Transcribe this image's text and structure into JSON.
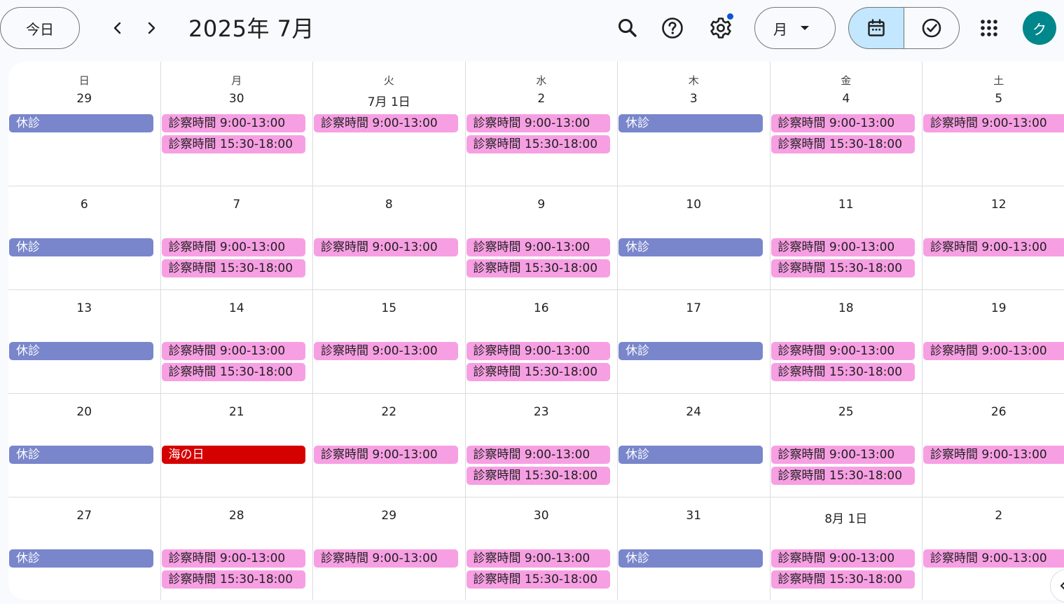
{
  "header": {
    "today_label": "今日",
    "month_title": "2025年 7月",
    "view_label": "月",
    "avatar_initial": "ク"
  },
  "colors": {
    "closed": "#7986cb",
    "hours": "#f79fe3",
    "holiday": "#d50000",
    "selected_segment": "#c2e7ff",
    "avatar": "#00878c",
    "notification_dot": "#0b57d0"
  },
  "weekdays": [
    "日",
    "月",
    "火",
    "水",
    "木",
    "金",
    "土"
  ],
  "weeks": [
    [
      {
        "date": "29",
        "events": [
          {
            "title": "休診",
            "kind": "closed"
          }
        ]
      },
      {
        "date": "30",
        "events": [
          {
            "title": "診察時間 9:00-13:00",
            "kind": "hours"
          },
          {
            "title": "診察時間 15:30-18:00",
            "kind": "hours"
          }
        ]
      },
      {
        "date": "7月 1日",
        "events": [
          {
            "title": "診察時間 9:00-13:00",
            "kind": "hours"
          }
        ]
      },
      {
        "date": "2",
        "events": [
          {
            "title": "診察時間 9:00-13:00",
            "kind": "hours"
          },
          {
            "title": "診察時間 15:30-18:00",
            "kind": "hours"
          }
        ]
      },
      {
        "date": "3",
        "events": [
          {
            "title": "休診",
            "kind": "closed"
          }
        ]
      },
      {
        "date": "4",
        "events": [
          {
            "title": "診察時間 9:00-13:00",
            "kind": "hours"
          },
          {
            "title": "診察時間 15:30-18:00",
            "kind": "hours"
          }
        ]
      },
      {
        "date": "5",
        "events": [
          {
            "title": "診察時間 9:00-13:00",
            "kind": "hours"
          }
        ]
      }
    ],
    [
      {
        "date": "6",
        "events": [
          {
            "title": "休診",
            "kind": "closed"
          }
        ]
      },
      {
        "date": "7",
        "events": [
          {
            "title": "診察時間 9:00-13:00",
            "kind": "hours"
          },
          {
            "title": "診察時間 15:30-18:00",
            "kind": "hours"
          }
        ]
      },
      {
        "date": "8",
        "events": [
          {
            "title": "診察時間 9:00-13:00",
            "kind": "hours"
          }
        ]
      },
      {
        "date": "9",
        "events": [
          {
            "title": "診察時間 9:00-13:00",
            "kind": "hours"
          },
          {
            "title": "診察時間 15:30-18:00",
            "kind": "hours"
          }
        ]
      },
      {
        "date": "10",
        "events": [
          {
            "title": "休診",
            "kind": "closed"
          }
        ]
      },
      {
        "date": "11",
        "events": [
          {
            "title": "診察時間 9:00-13:00",
            "kind": "hours"
          },
          {
            "title": "診察時間 15:30-18:00",
            "kind": "hours"
          }
        ]
      },
      {
        "date": "12",
        "events": [
          {
            "title": "診察時間 9:00-13:00",
            "kind": "hours"
          }
        ]
      }
    ],
    [
      {
        "date": "13",
        "events": [
          {
            "title": "休診",
            "kind": "closed"
          }
        ]
      },
      {
        "date": "14",
        "events": [
          {
            "title": "診察時間 9:00-13:00",
            "kind": "hours"
          },
          {
            "title": "診察時間 15:30-18:00",
            "kind": "hours"
          }
        ]
      },
      {
        "date": "15",
        "events": [
          {
            "title": "診察時間 9:00-13:00",
            "kind": "hours"
          }
        ]
      },
      {
        "date": "16",
        "events": [
          {
            "title": "診察時間 9:00-13:00",
            "kind": "hours"
          },
          {
            "title": "診察時間 15:30-18:00",
            "kind": "hours"
          }
        ]
      },
      {
        "date": "17",
        "events": [
          {
            "title": "休診",
            "kind": "closed"
          }
        ]
      },
      {
        "date": "18",
        "events": [
          {
            "title": "診察時間 9:00-13:00",
            "kind": "hours"
          },
          {
            "title": "診察時間 15:30-18:00",
            "kind": "hours"
          }
        ]
      },
      {
        "date": "19",
        "events": [
          {
            "title": "診察時間 9:00-13:00",
            "kind": "hours"
          }
        ]
      }
    ],
    [
      {
        "date": "20",
        "events": [
          {
            "title": "休診",
            "kind": "closed"
          }
        ]
      },
      {
        "date": "21",
        "events": [
          {
            "title": "海の日",
            "kind": "holiday"
          }
        ]
      },
      {
        "date": "22",
        "events": [
          {
            "title": "診察時間 9:00-13:00",
            "kind": "hours"
          }
        ]
      },
      {
        "date": "23",
        "events": [
          {
            "title": "診察時間 9:00-13:00",
            "kind": "hours"
          },
          {
            "title": "診察時間 15:30-18:00",
            "kind": "hours"
          }
        ]
      },
      {
        "date": "24",
        "events": [
          {
            "title": "休診",
            "kind": "closed"
          }
        ]
      },
      {
        "date": "25",
        "events": [
          {
            "title": "診察時間 9:00-13:00",
            "kind": "hours"
          },
          {
            "title": "診察時間 15:30-18:00",
            "kind": "hours"
          }
        ]
      },
      {
        "date": "26",
        "events": [
          {
            "title": "診察時間 9:00-13:00",
            "kind": "hours"
          }
        ]
      }
    ],
    [
      {
        "date": "27",
        "events": [
          {
            "title": "休診",
            "kind": "closed"
          }
        ]
      },
      {
        "date": "28",
        "events": [
          {
            "title": "診察時間 9:00-13:00",
            "kind": "hours"
          },
          {
            "title": "診察時間 15:30-18:00",
            "kind": "hours"
          }
        ]
      },
      {
        "date": "29",
        "events": [
          {
            "title": "診察時間 9:00-13:00",
            "kind": "hours"
          }
        ]
      },
      {
        "date": "30",
        "events": [
          {
            "title": "診察時間 9:00-13:00",
            "kind": "hours"
          },
          {
            "title": "診察時間 15:30-18:00",
            "kind": "hours"
          }
        ]
      },
      {
        "date": "31",
        "events": [
          {
            "title": "休診",
            "kind": "closed"
          }
        ]
      },
      {
        "date": "8月 1日",
        "events": [
          {
            "title": "診察時間 9:00-13:00",
            "kind": "hours"
          },
          {
            "title": "診察時間 15:30-18:00",
            "kind": "hours"
          }
        ]
      },
      {
        "date": "2",
        "events": [
          {
            "title": "診察時間 9:00-13:00",
            "kind": "hours"
          }
        ]
      }
    ]
  ]
}
